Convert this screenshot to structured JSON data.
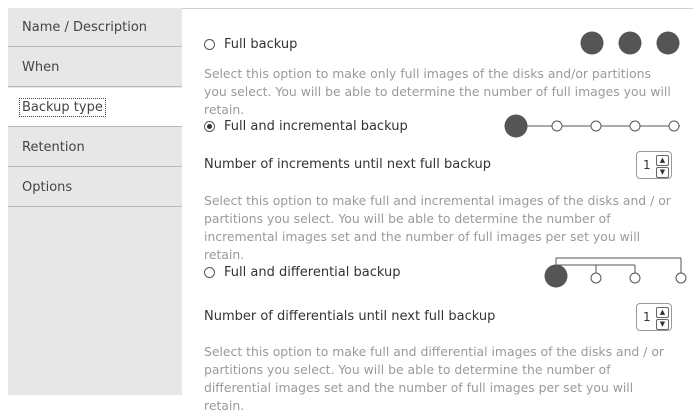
{
  "sidebar": {
    "items": [
      {
        "label": "Name / Description",
        "active": false
      },
      {
        "label": "When",
        "active": false
      },
      {
        "label": "Backup type",
        "active": true
      },
      {
        "label": "Retention",
        "active": false
      },
      {
        "label": "Options",
        "active": false
      }
    ]
  },
  "options": {
    "full": {
      "label": "Full backup",
      "checked": false,
      "description": "Select this option to make only full images of the disks and/or partitions you select. You will be able to determine the number of full images you will retain."
    },
    "incremental": {
      "label": "Full and incremental backup",
      "checked": true,
      "field_label": "Number of increments until next full backup",
      "field_value": "1",
      "description": "Select this option to make full and incremental images of the disks and / or partitions you select. You will be able to determine the number of incremental images set and the number of full images per set you will retain."
    },
    "differential": {
      "label": "Full and differential backup",
      "checked": false,
      "field_label": "Number of differentials until next full backup",
      "field_value": "1",
      "description": "Select this option to make full and differential images of the disks and / or partitions you select. You will be able to determine the number of differential images set and the number of full images per set you will retain."
    }
  },
  "icons": {
    "full_diagram": "three-full-images-icon",
    "incremental_diagram": "incremental-chain-icon",
    "differential_diagram": "differential-tree-icon",
    "step_up": "chevron-up-icon",
    "step_down": "chevron-down-icon"
  },
  "colors": {
    "sidebar_bg": "#e7e7e7",
    "full_node": "#555555",
    "description_text": "#9a9a9a"
  }
}
